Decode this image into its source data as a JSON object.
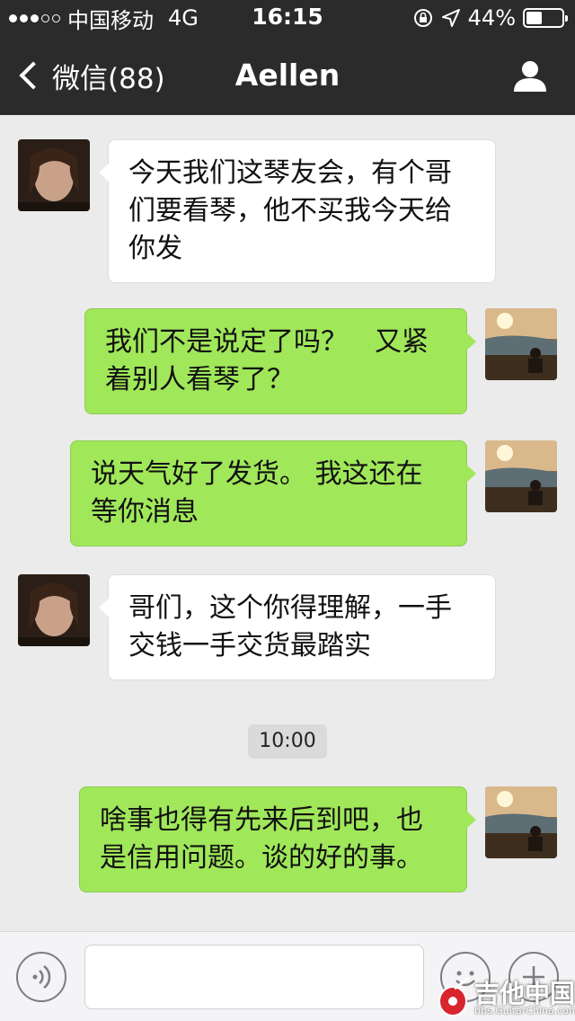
{
  "status_bar": {
    "carrier": "中国移动",
    "network": "4G",
    "time": "16:15",
    "battery_percent_label": "44%",
    "battery_level": 0.44
  },
  "nav": {
    "back_label": "微信(88)",
    "title": "Aellen"
  },
  "messages": [
    {
      "side": "in",
      "text": "今天我们这琴友会，有个哥们要看琴，他不买我今天给你发"
    },
    {
      "side": "out",
      "text": "我们不是说定了吗？　又紧着别人看琴了？"
    },
    {
      "side": "out",
      "text": "说天气好了发货。 我这还在等你消息"
    },
    {
      "side": "in",
      "text": "哥们，这个你得理解，一手交钱一手交货最踏实"
    },
    {
      "side": "out",
      "text": "啥事也得有先来后到吧，也是信用问题。谈的好的事。"
    }
  ],
  "timestamp": "10:00",
  "watermark": {
    "title": "吉他中国",
    "url": "bbs.GuitarChina.com"
  },
  "colors": {
    "header_bg": "#2b2b2b",
    "chat_bg": "#ebebeb",
    "outgoing_bubble": "#a0e75a",
    "incoming_bubble": "#ffffff"
  }
}
